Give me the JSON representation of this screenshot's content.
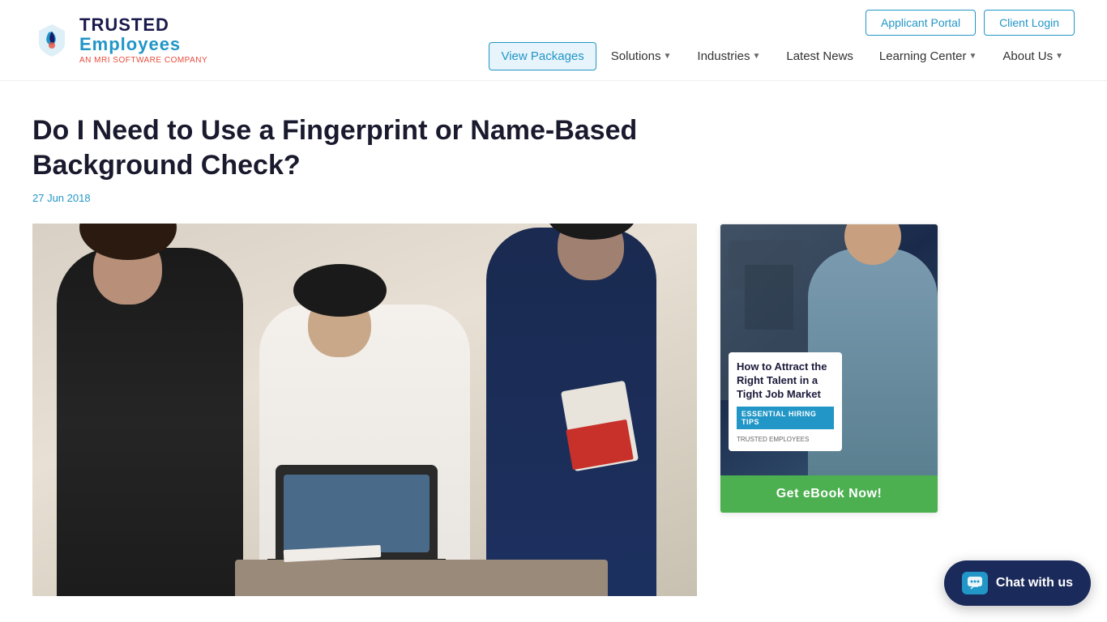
{
  "header": {
    "logo": {
      "trusted": "TRUSTED",
      "employees": "Employees",
      "mri": "AN MRI SOFTWARE COMPANY"
    },
    "buttons": {
      "applicant_portal": "Applicant Portal",
      "client_login": "Client Login"
    },
    "nav": {
      "view_packages": "View Packages",
      "solutions": "Solutions",
      "industries": "Industries",
      "latest_news": "Latest News",
      "learning_center": "Learning Center",
      "about_us": "About Us"
    }
  },
  "article": {
    "title": "Do I Need to Use a Fingerprint or Name-Based Background Check?",
    "date": "27 Jun 2018"
  },
  "sidebar": {
    "ebook": {
      "title": "How to Attract the Right Talent in a Tight Job Market",
      "subtitle": "ESSENTIAL HIRING TIPS",
      "logo": "TRUSTED EMPLOYEES",
      "cta": "Get eBook Now!"
    }
  },
  "chat": {
    "label": "Chat with us"
  }
}
